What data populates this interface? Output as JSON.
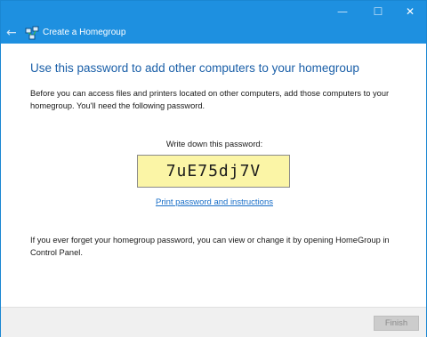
{
  "window": {
    "title": "Create a Homegroup",
    "controls": {
      "minimize": "—",
      "maximize": "☐",
      "close": "✕"
    },
    "back_glyph": "←"
  },
  "content": {
    "heading": "Use this password to add other computers to your homegroup",
    "intro": "Before you can access files and printers located on other computers, add those computers to your homegroup. You'll need the following password.",
    "password_label": "Write down this password:",
    "password": "7uE75dj7V",
    "print_link": "Print password and instructions",
    "footer": "If you ever forget your homegroup password, you can view or change it by opening HomeGroup in Control Panel."
  },
  "buttons": {
    "finish": "Finish"
  },
  "colors": {
    "titlebar": "#1e90e0",
    "heading": "#1a5fa8",
    "link": "#1a6fc8",
    "password_box": "#fbf5a6"
  }
}
